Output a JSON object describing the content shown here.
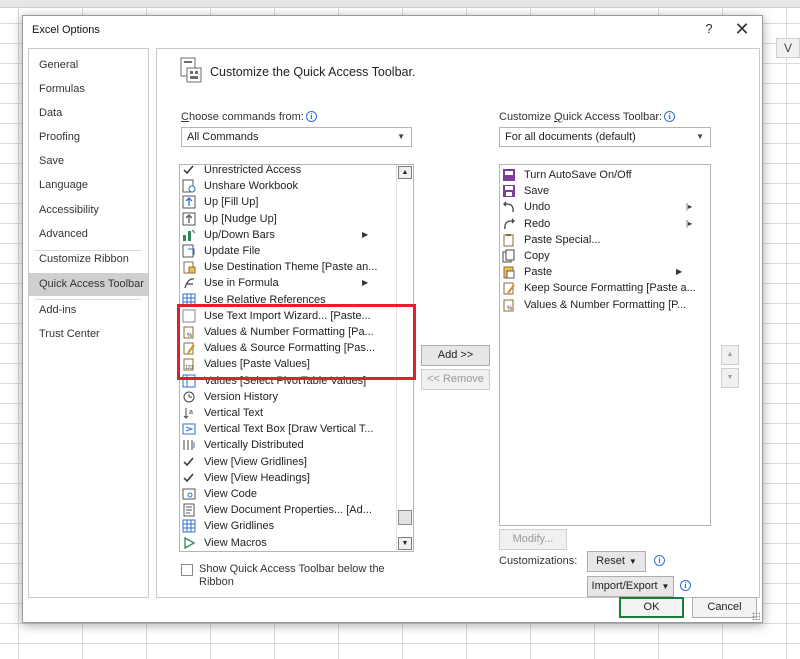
{
  "dialog": {
    "title": "Excel Options",
    "help": "?",
    "close": "✕"
  },
  "sheet": {
    "column_header_v": "V"
  },
  "nav": {
    "items": [
      {
        "label": "General"
      },
      {
        "label": "Formulas"
      },
      {
        "label": "Data"
      },
      {
        "label": "Proofing"
      },
      {
        "label": "Save"
      },
      {
        "label": "Language"
      },
      {
        "label": "Accessibility"
      },
      {
        "label": "Advanced"
      },
      {
        "label": "Customize Ribbon"
      },
      {
        "label": "Quick Access Toolbar",
        "selected": true
      },
      {
        "label": "Add-ins"
      },
      {
        "label": "Trust Center"
      }
    ]
  },
  "main": {
    "header": "Customize the Quick Access Toolbar.",
    "choose_label_prefix": "C",
    "choose_label_rest": "hoose commands from:",
    "choose_value": "All Commands",
    "customize_label_a": "Customize ",
    "customize_label_u": "Q",
    "customize_label_b": "uick Access Toolbar:",
    "customize_value": "For all documents (default)",
    "commands": [
      {
        "label": "Unrestricted Access",
        "icon": "check-icon"
      },
      {
        "label": "Unshare Workbook",
        "icon": "unshare-workbook-icon"
      },
      {
        "label": "Up [Fill Up]",
        "icon": "fill-up-icon"
      },
      {
        "label": "Up [Nudge Up]",
        "icon": "nudge-up-icon"
      },
      {
        "label": "Up/Down Bars",
        "icon": "up-down-bars-icon",
        "submenu": true
      },
      {
        "label": "Update File",
        "icon": "update-file-icon"
      },
      {
        "label": "Use Destination Theme [Paste an...",
        "icon": "paste-destination-theme-icon"
      },
      {
        "label": "Use in Formula",
        "icon": "use-in-formula-icon",
        "submenu": true
      },
      {
        "label": "Use Relative References",
        "icon": "relative-references-icon"
      },
      {
        "label": "Use Text Import Wizard... [Paste...",
        "icon": "text-import-icon"
      },
      {
        "label": "Values & Number Formatting [Pa...",
        "icon": "paste-values-number-formatting-icon"
      },
      {
        "label": "Values & Source Formatting [Pas...",
        "icon": "paste-values-source-formatting-icon"
      },
      {
        "label": "Values [Paste Values]",
        "icon": "paste-values-icon"
      },
      {
        "label": "Values [Select PivotTable Values]",
        "icon": "pivottable-values-icon"
      },
      {
        "label": "Version History",
        "icon": "version-history-icon"
      },
      {
        "label": "Vertical Text",
        "icon": "vertical-text-icon"
      },
      {
        "label": "Vertical Text Box [Draw Vertical T...",
        "icon": "vertical-text-box-icon"
      },
      {
        "label": "Vertically Distributed",
        "icon": "vertically-distributed-icon"
      },
      {
        "label": "View [View Gridlines]",
        "icon": "check-icon"
      },
      {
        "label": "View [View Headings]",
        "icon": "check-icon"
      },
      {
        "label": "View Code",
        "icon": "view-code-icon"
      },
      {
        "label": "View Document Properties... [Ad...",
        "icon": "document-properties-icon"
      },
      {
        "label": "View Gridlines",
        "icon": "gridlines-icon"
      },
      {
        "label": "View Macros",
        "icon": "macros-play-icon"
      }
    ],
    "toolbar_items": [
      {
        "label": "Turn AutoSave On/Off",
        "icon": "autosave-icon"
      },
      {
        "label": "Save",
        "icon": "save-icon"
      },
      {
        "label": "Undo",
        "icon": "undo-icon",
        "splitter": true
      },
      {
        "label": "Redo",
        "icon": "redo-icon",
        "splitter": true
      },
      {
        "label": "Paste Special...",
        "icon": "paste-special-icon"
      },
      {
        "label": "Copy",
        "icon": "copy-icon"
      },
      {
        "label": "Paste",
        "icon": "paste-icon",
        "submenu": true
      },
      {
        "label": "Keep Source Formatting [Paste a...",
        "icon": "keep-source-formatting-icon"
      },
      {
        "label": "Values & Number Formatting [P...",
        "icon": "paste-values-number-formatting-icon"
      }
    ],
    "add_button": "Add >>",
    "remove_button": "<< Remove",
    "modify_button": "Modify...",
    "customizations_label": "Customizations:",
    "reset_button": "Reset",
    "import_export_button": "Import/Export",
    "show_below_label_line1": "Show Quick Access Toolbar below the",
    "show_below_label_line2": "Ribbon",
    "show_below_checked": false
  },
  "footer": {
    "ok": "OK",
    "cancel": "Cancel"
  },
  "colors": {
    "highlight": "#e0202a",
    "selected_nav": "#cfcfcf",
    "ok_border": "#1c7c3c",
    "info_blue": "#2f6fd6"
  }
}
